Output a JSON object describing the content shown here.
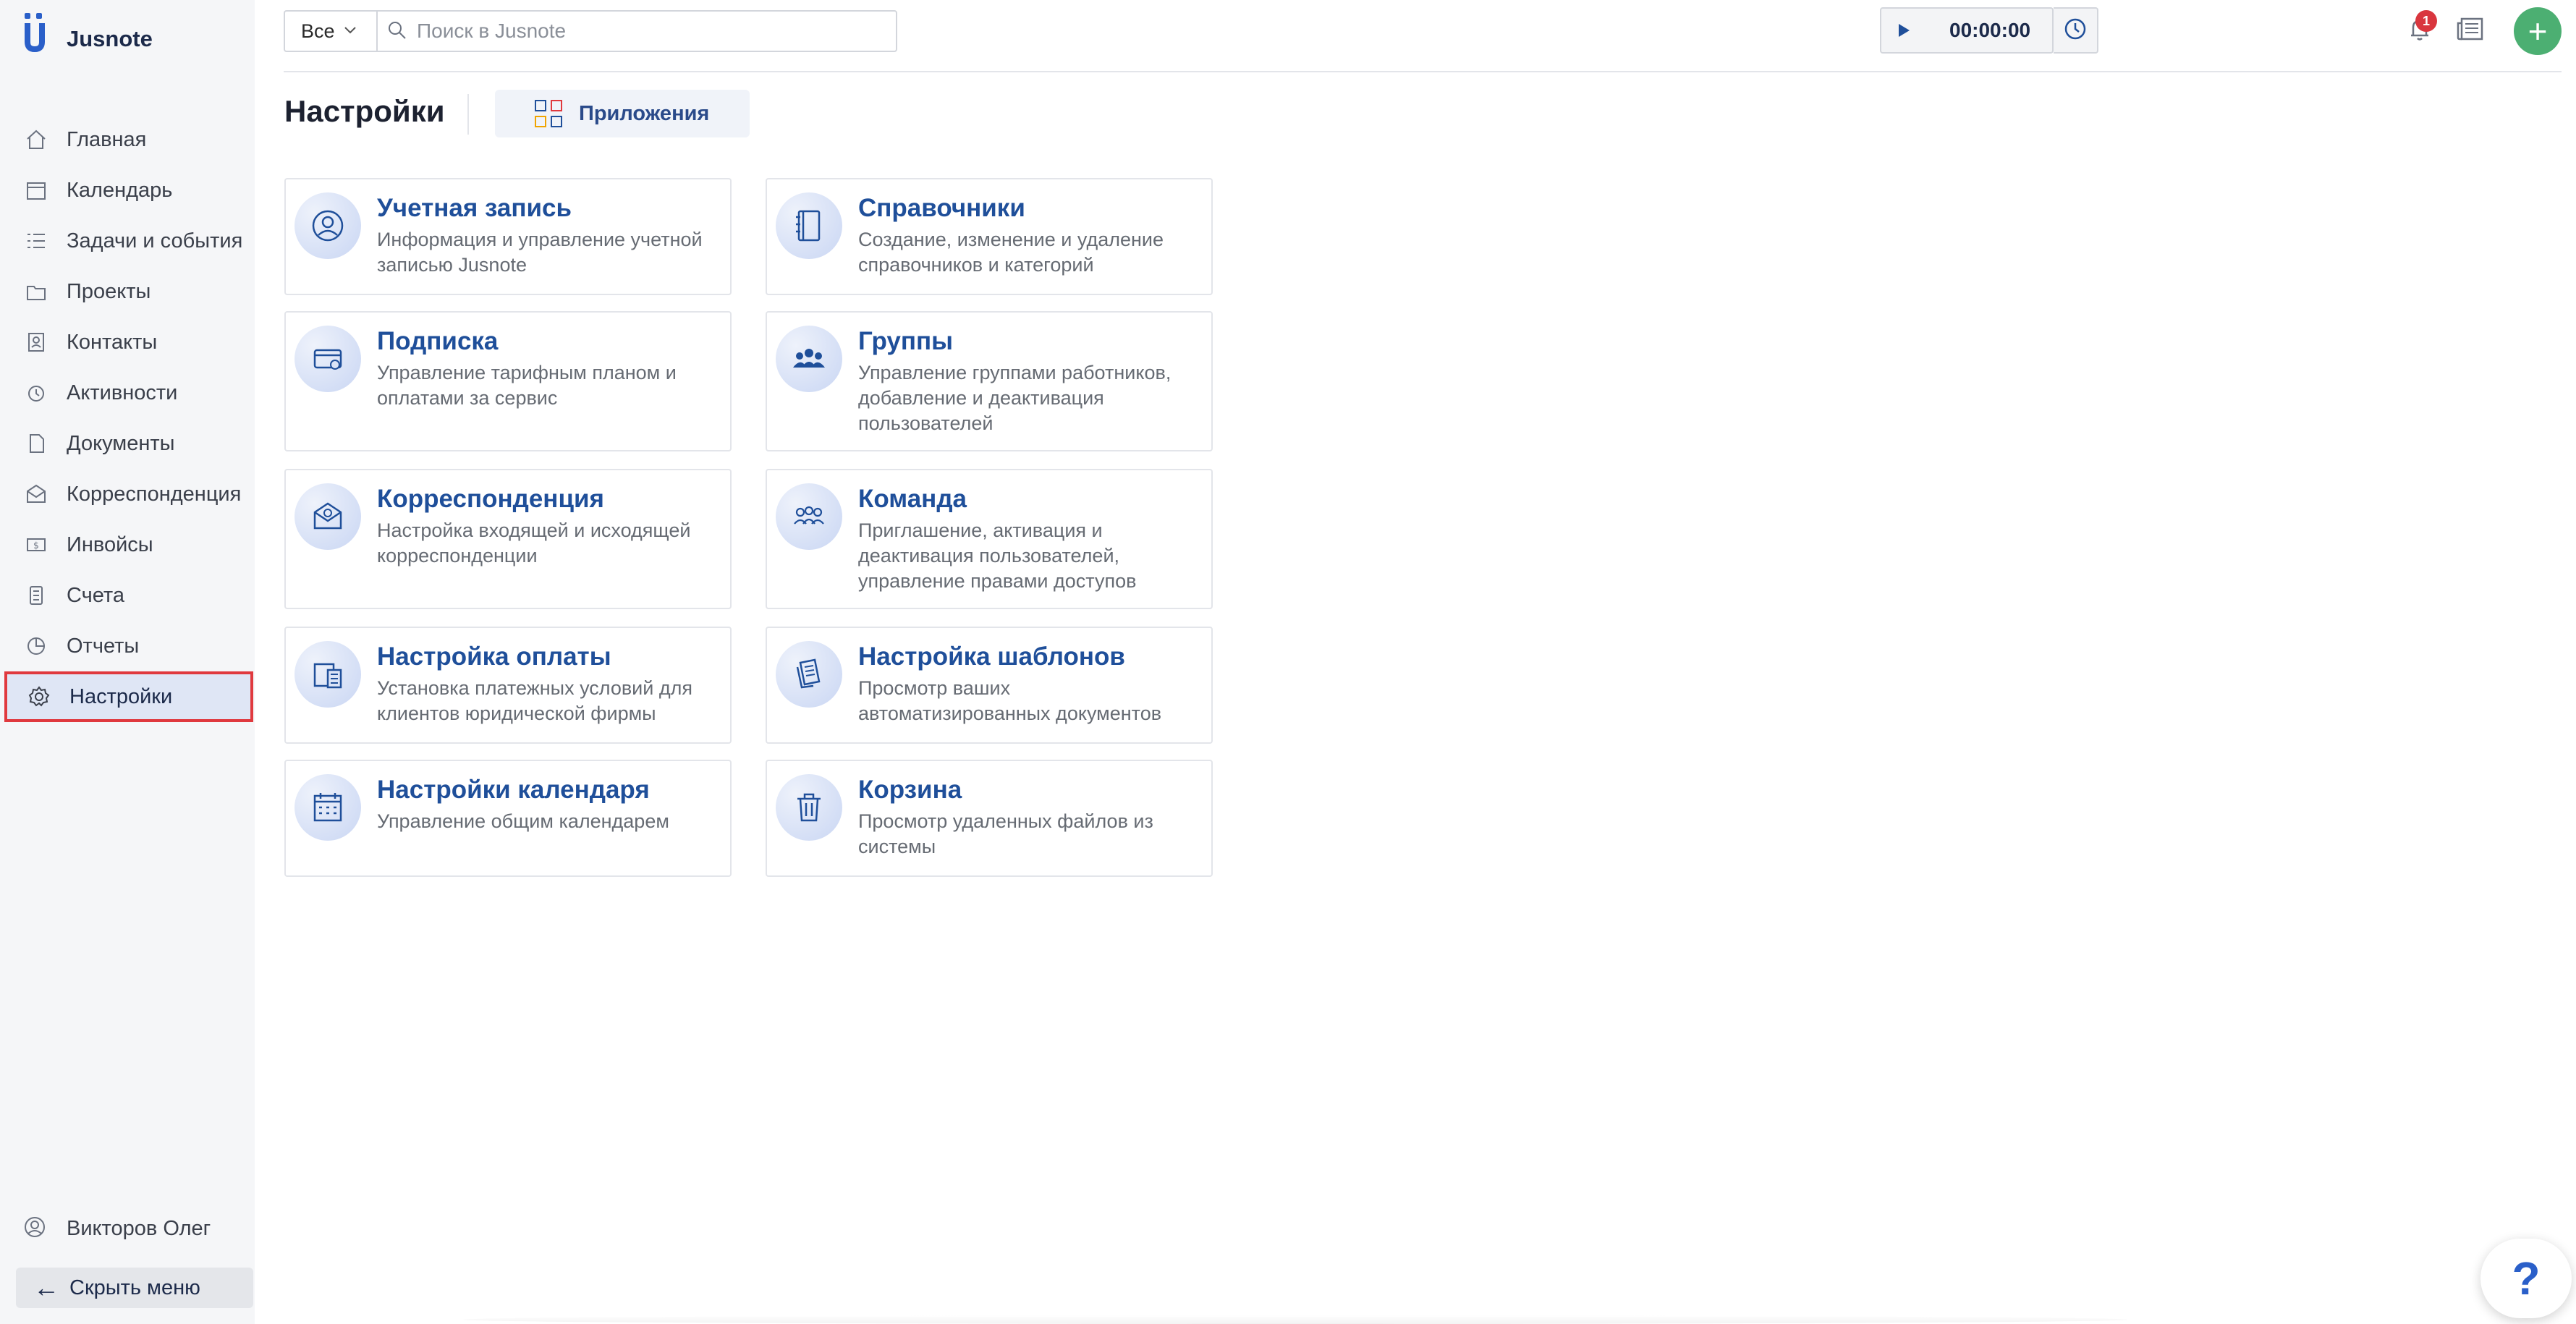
{
  "app": {
    "name": "Jusnote"
  },
  "sidebar": {
    "items": [
      {
        "label": "Главная",
        "icon": "home-icon"
      },
      {
        "label": "Календарь",
        "icon": "calendar-icon"
      },
      {
        "label": "Задачи и события",
        "icon": "tasks-icon"
      },
      {
        "label": "Проекты",
        "icon": "projects-icon"
      },
      {
        "label": "Контакты",
        "icon": "contacts-icon"
      },
      {
        "label": "Активности",
        "icon": "activities-icon"
      },
      {
        "label": "Документы",
        "icon": "documents-icon"
      },
      {
        "label": "Корреспонденция",
        "icon": "correspondence-icon"
      },
      {
        "label": "Инвойсы",
        "icon": "invoices-icon"
      },
      {
        "label": "Счета",
        "icon": "accounts-icon"
      },
      {
        "label": "Отчеты",
        "icon": "reports-icon"
      },
      {
        "label": "Настройки",
        "icon": "gear-icon",
        "active": true
      }
    ],
    "user_name": "Викторов Олег",
    "hide_menu_label": "Скрыть меню"
  },
  "topbar": {
    "scope_value": "Все",
    "search_placeholder": "Поиск в Jusnote",
    "timer_value": "00:00:00",
    "notification_count": "1"
  },
  "header": {
    "title": "Настройки",
    "apps_label": "Приложения"
  },
  "cards": [
    {
      "title": "Учетная запись",
      "desc": "Информация и управление учетной записью Jusnote",
      "icon": "account-icon"
    },
    {
      "title": "Справочники",
      "desc": "Создание, изменение и удаление справочников и категорий",
      "icon": "directory-icon"
    },
    {
      "title": "Подписка",
      "desc": "Управление тарифным планом и оплатами за сервис",
      "icon": "subscription-icon"
    },
    {
      "title": "Группы",
      "desc": "Управление группами работников, добавление и деактивация пользователей",
      "icon": "groups-icon"
    },
    {
      "title": "Корреспонденция",
      "desc": "Настройка входящей и исходящей корреспонденции",
      "icon": "mail-icon"
    },
    {
      "title": "Команда",
      "desc": "Приглашение, активация и деактивация пользователей, управление правами доступов",
      "icon": "team-icon"
    },
    {
      "title": "Настройка оплаты",
      "desc": "Установка платежных условий для клиентов юридической фирмы",
      "icon": "payment-icon"
    },
    {
      "title": "Настройка шаблонов",
      "desc": "Просмотр ваших автоматизированных документов",
      "icon": "templates-icon"
    },
    {
      "title": "Настройки календаря",
      "desc": "Управление общим календарем",
      "icon": "calendar-icon"
    },
    {
      "title": "Корзина",
      "desc": "Просмотр удаленных файлов из системы",
      "icon": "trash-icon"
    }
  ],
  "help_label": "?",
  "colors": {
    "accent": "#1f4f9a",
    "active_border": "#e0393e",
    "add_button": "#4caf72",
    "badge": "#d9363e"
  }
}
